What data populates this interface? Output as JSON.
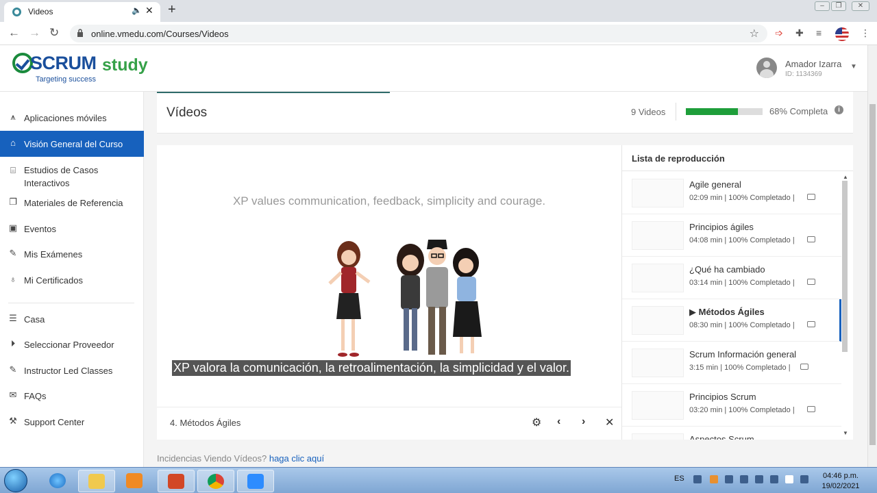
{
  "browser": {
    "tab_title": "Videos",
    "url": "online.vmedu.com/Courses/Videos"
  },
  "brand": {
    "word1": "SCRUM",
    "word2": "study",
    "tagline": "Targeting success",
    "blue": "#1a4f9c",
    "green": "#35a148"
  },
  "user": {
    "name": "Amador Izarra",
    "id": "ID: 1134369"
  },
  "sidebar": {
    "items": [
      {
        "label": "Aplicaciones móviles",
        "icon": "mobile-apps-icon",
        "glyph": "⩚",
        "active": false
      },
      {
        "label": "Visión General del Curso",
        "icon": "home-icon",
        "glyph": "⌂",
        "active": true
      },
      {
        "label": "Estudios de Casos Interactivos",
        "icon": "case-study-icon",
        "glyph": "⌸",
        "active": false
      },
      {
        "label": "Materiales de Referencia",
        "icon": "copy-icon",
        "glyph": "❐",
        "active": false
      },
      {
        "label": "Eventos",
        "icon": "calendar-icon",
        "glyph": "▣",
        "active": false
      },
      {
        "label": "Mis Exámenes",
        "icon": "edit-icon",
        "glyph": "✎",
        "active": false
      },
      {
        "label": "Mi Certificados",
        "icon": "award-icon",
        "glyph": "♁",
        "active": false
      },
      {
        "label": "Casa",
        "icon": "list-icon",
        "glyph": "☰",
        "active": false
      },
      {
        "label": "Seleccionar Proveedor",
        "icon": "skip-icon",
        "glyph": "⏵",
        "active": false
      },
      {
        "label": "Instructor Led Classes",
        "icon": "edit-icon",
        "glyph": "✎",
        "active": false
      },
      {
        "label": "FAQs",
        "icon": "chat-icon",
        "glyph": "✉",
        "active": false
      },
      {
        "label": "Support Center",
        "icon": "support-icon",
        "glyph": "⚒",
        "active": false
      }
    ]
  },
  "videos": {
    "title": "Vídeos",
    "count": "9 Videos",
    "progress_fraction": 0.68,
    "progress_text": "68% Completa",
    "progress_color": "#1e9e3a"
  },
  "player": {
    "slide_text": "XP values communication, feedback, simplicity and courage.",
    "caption": "XP valora la comunicación, la retroalimentación, la simplicidad y el valor.",
    "current_title": "4. Métodos Ágiles"
  },
  "playlist": {
    "heading": "Lista de reproducción",
    "items": [
      {
        "title": "Agile general",
        "meta": "02:09 min | 100% Completado |",
        "active": false
      },
      {
        "title": "Principios ágiles",
        "meta": "04:08 min | 100% Completado |",
        "active": false
      },
      {
        "title": "¿Qué ha cambiado",
        "meta": "03:14 min | 100% Completado |",
        "active": false
      },
      {
        "title": "▶ Métodos Ágiles",
        "meta": "08:30 min | 100% Completado |",
        "active": true
      },
      {
        "title": "Scrum Información general",
        "meta": "3:15 min | 100% Completado |",
        "active": false
      },
      {
        "title": "Principios Scrum",
        "meta": "03:20 min | 100% Completado |",
        "active": false
      },
      {
        "title": "Aspectos Scrum",
        "meta": "",
        "active": false
      }
    ]
  },
  "issue": {
    "text": "Incidencias Viendo Vídeos?",
    "link": "haga clic aquí"
  },
  "taskbar": {
    "lang": "ES",
    "time": "04:46 p.m.",
    "date": "19/02/2021"
  },
  "colors": {
    "accent": "#1761bd"
  }
}
